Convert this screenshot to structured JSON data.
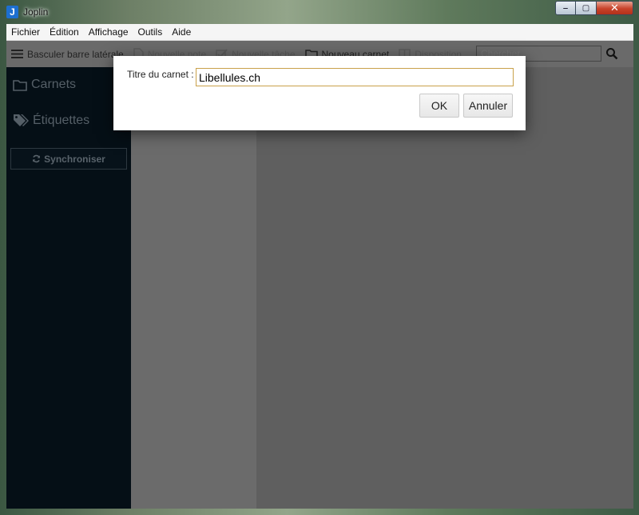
{
  "window": {
    "app_icon_letter": "J",
    "title": "Joplin",
    "min_glyph": "‒",
    "max_glyph": "▢",
    "close_glyph": "✕"
  },
  "menubar": {
    "items": [
      "Fichier",
      "Édition",
      "Affichage",
      "Outils",
      "Aide"
    ]
  },
  "toolbar": {
    "toggle_sidebar": "Basculer barre latérale",
    "new_note": "Nouvelle note",
    "new_todo": "Nouvelle tâche",
    "new_notebook": "Nouveau carnet",
    "layout": "Disposition",
    "search_placeholder": "Chercher..."
  },
  "sidebar": {
    "notebooks_label": "Carnets",
    "tags_label": "Étiquettes",
    "sync_label": "Synchroniser"
  },
  "dialog": {
    "label": "Titre du carnet :",
    "input_value": "Libellules.ch",
    "ok_label": "OK",
    "cancel_label": "Annuler"
  },
  "colors": {
    "sidebar_bg": "#050f16",
    "overlay_gray": "#5f5f5f",
    "input_border": "#c9a14a"
  }
}
